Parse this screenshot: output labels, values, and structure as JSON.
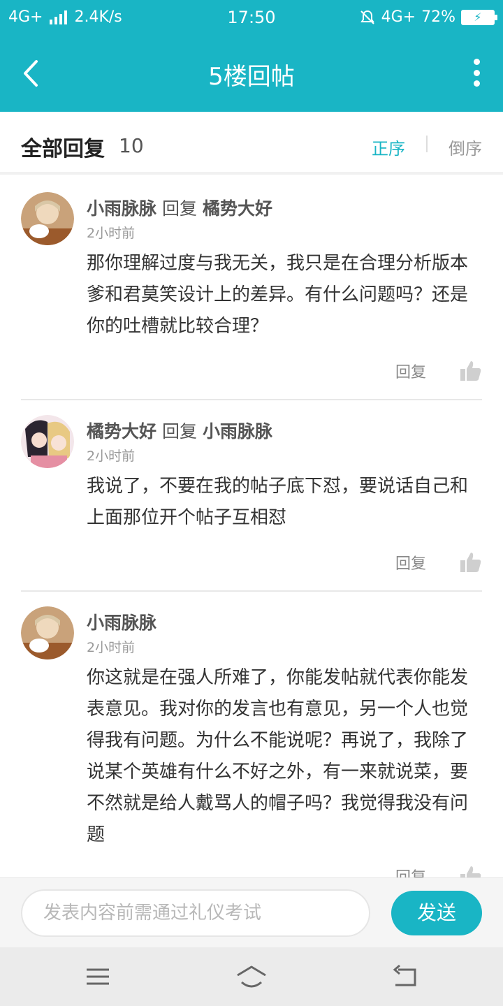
{
  "status_bar": {
    "network_left": "4G+",
    "speed": "2.4K/s",
    "time": "17:50",
    "network_right": "4G+",
    "battery": "72%"
  },
  "nav": {
    "title": "5楼回帖"
  },
  "sort_bar": {
    "heading": "全部回复",
    "count": "10",
    "asc_label": "正序",
    "desc_label": "倒序"
  },
  "replies": [
    {
      "author": "小雨脉脉",
      "reply_word": "回复",
      "reply_to": "橘势大好",
      "time": "2小时前",
      "content": "那你理解过度与我无关，我只是在合理分析版本爹和君莫笑设计上的差异。有什么问题吗？还是你的吐槽就比较合理？",
      "reply_label": "回复"
    },
    {
      "author": "橘势大好",
      "reply_word": "回复",
      "reply_to": "小雨脉脉",
      "time": "2小时前",
      "content": "我说了，不要在我的帖子底下怼，要说话自己和上面那位开个帖子互相怼",
      "reply_label": "回复"
    },
    {
      "author": "小雨脉脉",
      "time": "2小时前",
      "content": "你这就是在强人所难了，你能发帖就代表你能发表意见。我对你的发言也有意见，另一个人也觉得我有问题。为什么不能说呢？再说了，我除了说某个英雄有什么不好之外，有一来就说菜，要不然就是给人戴骂人的帽子吗？我觉得我没有问题",
      "reply_label": "回复"
    }
  ],
  "input_bar": {
    "placeholder": "发表内容前需通过礼仪考试",
    "send_label": "发送"
  },
  "colors": {
    "accent": "#19b5c5"
  }
}
